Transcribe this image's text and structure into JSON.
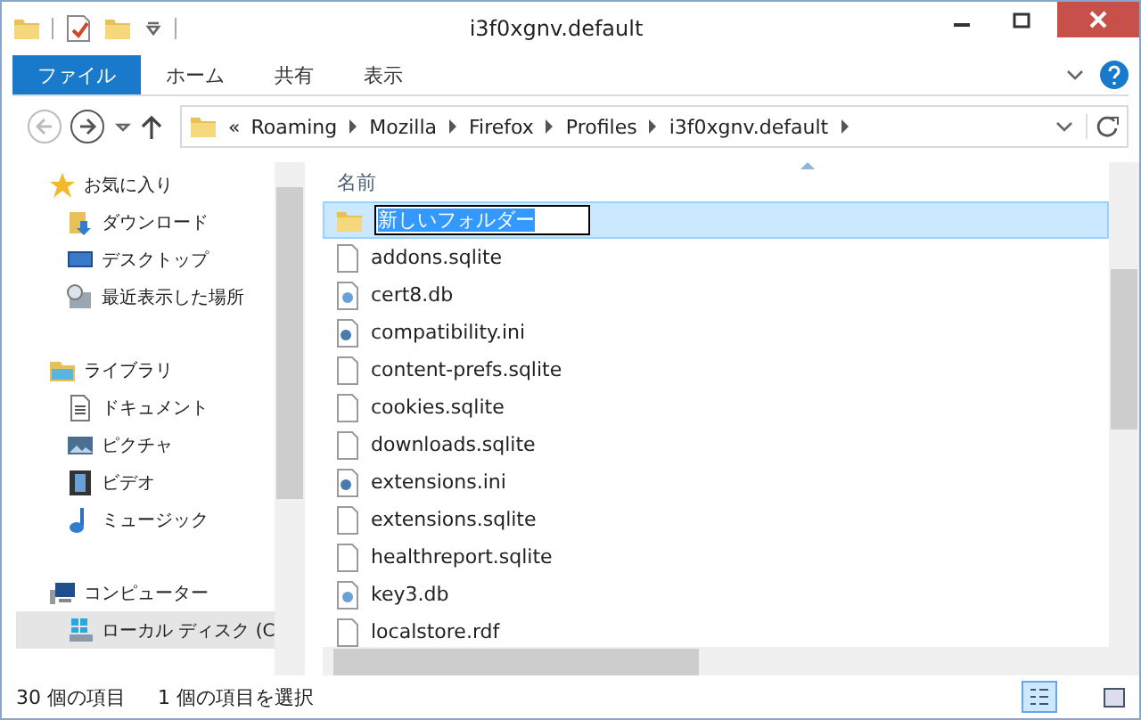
{
  "window": {
    "title": "i3f0xgnv.default"
  },
  "ribbon_tabs": [
    {
      "label": "ファイル",
      "selected": true
    },
    {
      "label": "ホーム",
      "selected": false
    },
    {
      "label": "共有",
      "selected": false
    },
    {
      "label": "表示",
      "selected": false
    }
  ],
  "address_bar": {
    "overflow": "«",
    "segments": [
      "Roaming",
      "Mozilla",
      "Firefox",
      "Profiles",
      "i3f0xgnv.default"
    ]
  },
  "sidebar": {
    "items": [
      {
        "kind": "favorites",
        "label": "お気に入り",
        "group": true,
        "selected": false
      },
      {
        "kind": "downloads",
        "label": "ダウンロード",
        "group": false,
        "selected": false
      },
      {
        "kind": "desktop",
        "label": "デスクトップ",
        "group": false,
        "selected": false
      },
      {
        "kind": "recent",
        "label": "最近表示した場所",
        "group": false,
        "selected": false
      },
      {
        "kind": "libraries",
        "label": "ライブラリ",
        "group": true,
        "selected": false
      },
      {
        "kind": "documents",
        "label": "ドキュメント",
        "group": false,
        "selected": false
      },
      {
        "kind": "pictures",
        "label": "ピクチャ",
        "group": false,
        "selected": false
      },
      {
        "kind": "videos",
        "label": "ビデオ",
        "group": false,
        "selected": false
      },
      {
        "kind": "music",
        "label": "ミュージック",
        "group": false,
        "selected": false
      },
      {
        "kind": "computer",
        "label": "コンピューター",
        "group": true,
        "selected": false
      },
      {
        "kind": "drive",
        "label": "ローカル ディスク (C",
        "group": false,
        "selected": true
      }
    ]
  },
  "file_list": {
    "column": "名前",
    "files": [
      {
        "kind": "folder",
        "name": "新しいフォルダー",
        "selected": true,
        "editing": true
      },
      {
        "kind": "file",
        "name": "addons.sqlite",
        "selected": false,
        "editing": false
      },
      {
        "kind": "db",
        "name": "cert8.db",
        "selected": false,
        "editing": false
      },
      {
        "kind": "ini",
        "name": "compatibility.ini",
        "selected": false,
        "editing": false
      },
      {
        "kind": "file",
        "name": "content-prefs.sqlite",
        "selected": false,
        "editing": false
      },
      {
        "kind": "file",
        "name": "cookies.sqlite",
        "selected": false,
        "editing": false
      },
      {
        "kind": "file",
        "name": "downloads.sqlite",
        "selected": false,
        "editing": false
      },
      {
        "kind": "ini",
        "name": "extensions.ini",
        "selected": false,
        "editing": false
      },
      {
        "kind": "file",
        "name": "extensions.sqlite",
        "selected": false,
        "editing": false
      },
      {
        "kind": "file",
        "name": "healthreport.sqlite",
        "selected": false,
        "editing": false
      },
      {
        "kind": "db",
        "name": "key3.db",
        "selected": false,
        "editing": false
      },
      {
        "kind": "file",
        "name": "localstore.rdf",
        "selected": false,
        "editing": false
      }
    ]
  },
  "status_bar": {
    "item_count": "30 個の項目",
    "selection": "1 個の項目を選択"
  }
}
